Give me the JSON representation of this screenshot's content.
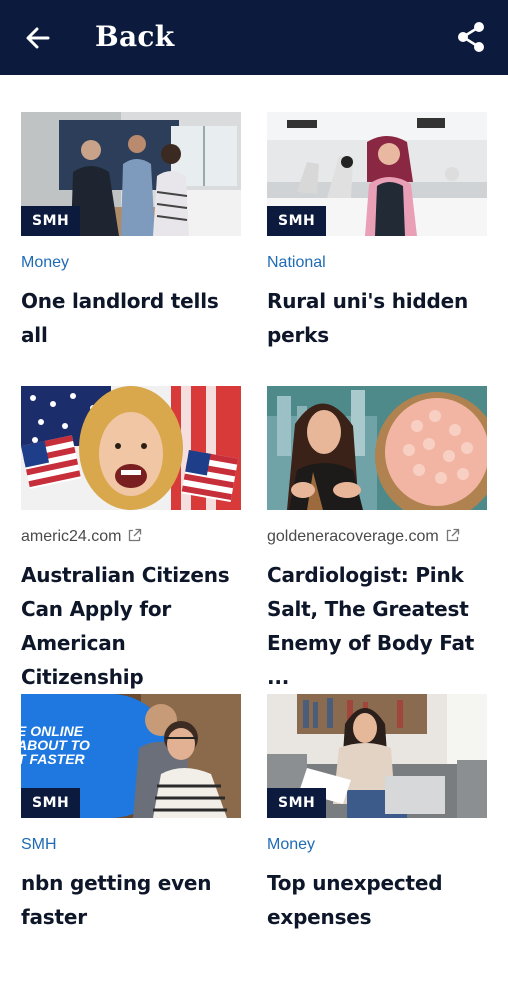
{
  "header": {
    "back_label": "Back",
    "background_color": "#0b1a3d"
  },
  "accent_color": "#1f6bb5",
  "cards": [
    {
      "source": "Money",
      "source_external": false,
      "badge": "SMH",
      "headline": "One landlord tells all",
      "image": "landlord-handshake-photo"
    },
    {
      "source": "National",
      "source_external": false,
      "badge": "SMH",
      "headline": "Rural uni's hidden perks",
      "image": "university-lab-photo"
    },
    {
      "source": "americ24.com",
      "source_external": true,
      "badge": "",
      "headline": "Australian Citizens Can Apply for American Citizenship",
      "image": "woman-with-us-flags-photo"
    },
    {
      "source": "goldeneracoverage.com",
      "source_external": true,
      "badge": "",
      "headline": "Cardiologist: Pink Salt, The Greatest Enemy of Body Fat ...",
      "image": "pink-salt-bowl-photo"
    },
    {
      "source": "SMH",
      "source_external": false,
      "badge": "SMH",
      "headline": "nbn getting even faster",
      "image": "couple-watching-screen-photo",
      "image_text": "E ONLINE\nABOUT TO\nT FASTER"
    },
    {
      "source": "Money",
      "source_external": false,
      "badge": "SMH",
      "headline": "Top unexpected expenses",
      "image": "woman-with-bills-photo"
    }
  ]
}
